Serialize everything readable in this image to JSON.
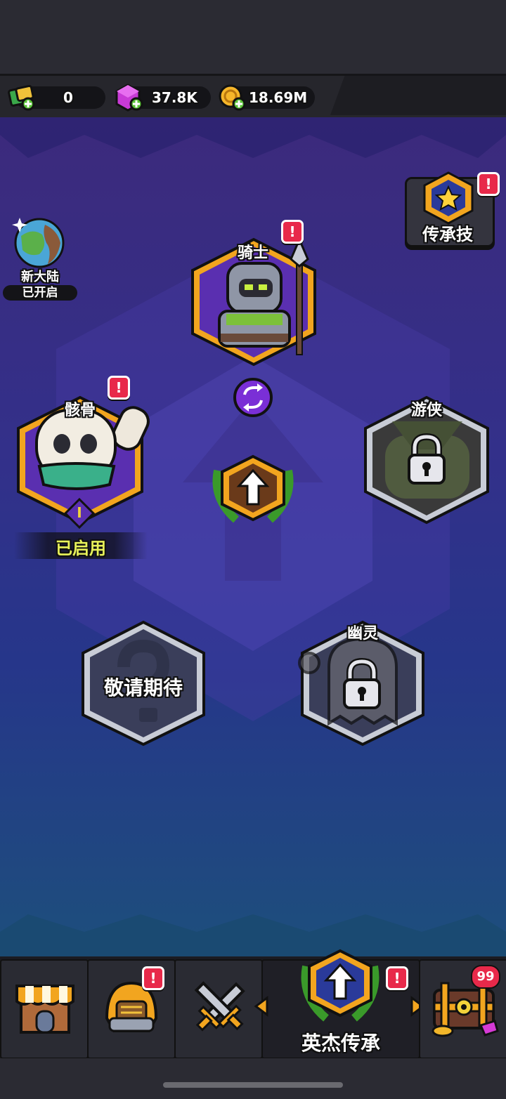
{
  "currencies": {
    "tickets": {
      "value": "0",
      "icon": "ticket-icon"
    },
    "gems": {
      "value": "37.8K",
      "icon": "gem-icon"
    },
    "gold": {
      "value": "18.69M",
      "icon": "coin-icon"
    }
  },
  "new_continent": {
    "title": "新大陆",
    "status": "已开启"
  },
  "legacy_skill": {
    "label": "传承技"
  },
  "heroes": {
    "knight": {
      "name": "骑士"
    },
    "skeleton": {
      "name": "骸骨",
      "level": "I",
      "status": "已启用"
    },
    "ranger": {
      "name": "游侠"
    },
    "ghost": {
      "name": "幽灵"
    },
    "coming_soon": {
      "label": "敬请期待"
    }
  },
  "alert_mark": "!",
  "bottom_nav": {
    "tabs": [
      {
        "name": "shop",
        "icon": "shop-icon"
      },
      {
        "name": "equipment",
        "icon": "helmet-icon"
      },
      {
        "name": "battle",
        "icon": "crossed-swords-icon"
      },
      {
        "name": "hero-legacy",
        "label": "英杰传承",
        "icon": "upgrade-arrow-icon"
      },
      {
        "name": "chest",
        "badge": "99",
        "icon": "treasure-chest-icon"
      }
    ]
  },
  "colors": {
    "accent_gold": "#f2a51f",
    "alert_red": "#e8294a",
    "active_purple": "#5a2fb0"
  }
}
